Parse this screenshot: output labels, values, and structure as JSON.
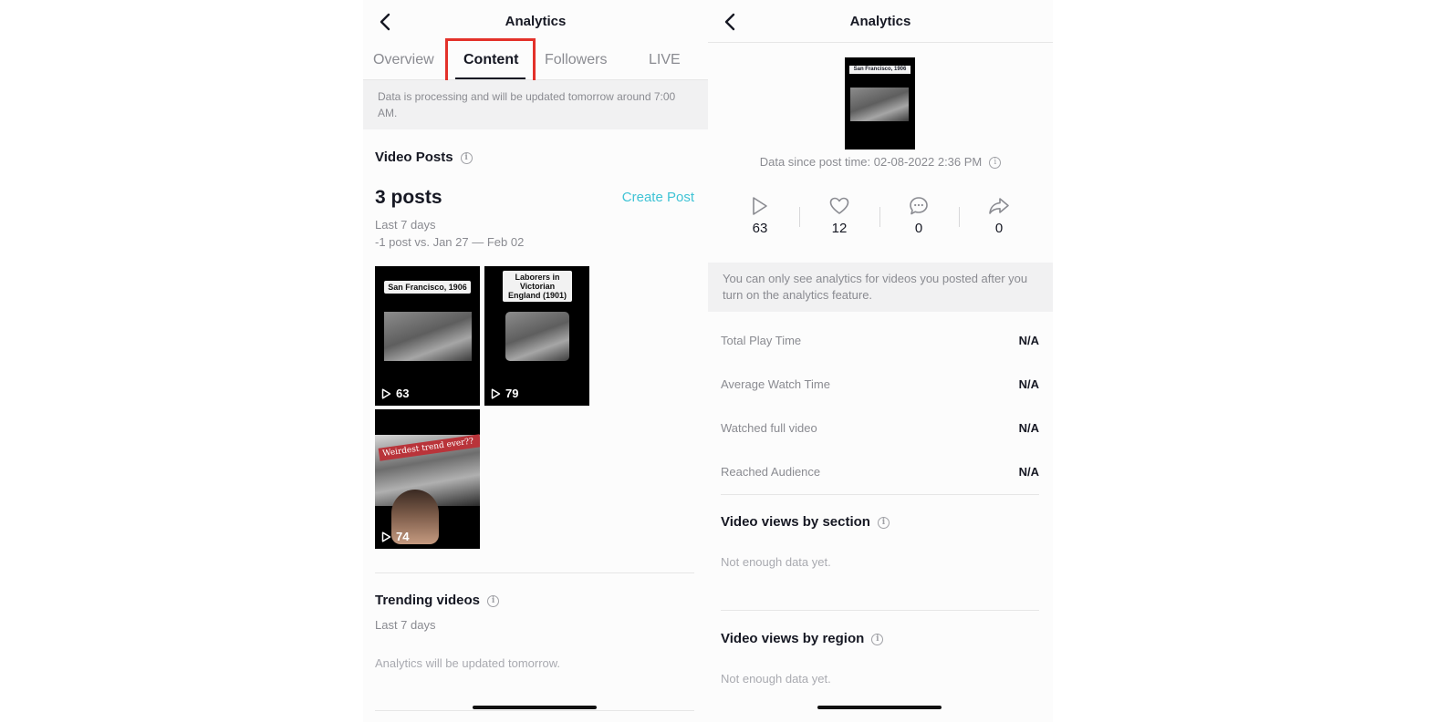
{
  "left": {
    "title": "Analytics",
    "tabs": [
      {
        "label": "Overview"
      },
      {
        "label": "Content"
      },
      {
        "label": "Followers"
      },
      {
        "label": "LIVE"
      }
    ],
    "notice": "Data is processing and will be updated tomorrow around 7:00 AM.",
    "video_posts_heading": "Video Posts",
    "posts_count": "3 posts",
    "create_post": "Create Post",
    "period": "Last 7 days",
    "comparison": "-1 post vs. Jan 27 — Feb 02",
    "videos": [
      {
        "caption": "San Francisco, 1906",
        "views": "63"
      },
      {
        "caption": "Laborers in Victorian England (1901)",
        "views": "79"
      },
      {
        "caption": "Weirdest trend ever??",
        "views": "74"
      }
    ],
    "trending_heading": "Trending videos",
    "trending_period": "Last 7 days",
    "trending_note": "Analytics will be updated tomorrow."
  },
  "right": {
    "title": "Analytics",
    "thumb_caption": "San Francisco, 1906",
    "since": "Data since post time: 02-08-2022 2:36 PM",
    "metrics": [
      {
        "icon": "play-icon",
        "value": "63"
      },
      {
        "icon": "heart-icon",
        "value": "12"
      },
      {
        "icon": "comment-icon",
        "value": "0"
      },
      {
        "icon": "share-icon",
        "value": "0"
      }
    ],
    "notice": "You can only see analytics for videos you posted after you turn on the analytics feature.",
    "stats": [
      {
        "label": "Total Play Time",
        "value": "N/A"
      },
      {
        "label": "Average Watch Time",
        "value": "N/A"
      },
      {
        "label": "Watched full video",
        "value": "N/A"
      },
      {
        "label": "Reached Audience",
        "value": "N/A"
      }
    ],
    "section_heading": "Video views by section",
    "section_note": "Not enough data yet.",
    "region_heading": "Video views by region",
    "region_note": "Not enough data yet."
  },
  "colors": {
    "accent": "#3fc3d5",
    "highlight": "#e3312a",
    "text": "#161823",
    "muted": "#8a8b91"
  }
}
